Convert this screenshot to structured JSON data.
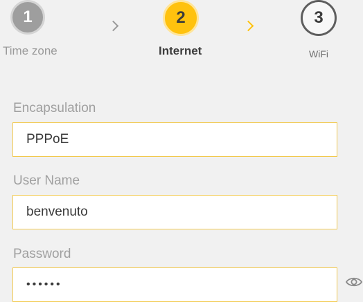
{
  "stepper": {
    "steps": [
      {
        "number": "1",
        "label": "Time zone",
        "state": "completed"
      },
      {
        "number": "2",
        "label": "Internet",
        "state": "active"
      },
      {
        "number": "3",
        "label": "WiFi",
        "state": "pending"
      }
    ],
    "separator_icon": "chevron-right-icon"
  },
  "form": {
    "encapsulation": {
      "label": "Encapsulation",
      "value": "PPPoE"
    },
    "username": {
      "label": "User Name",
      "value": "benvenuto"
    },
    "password": {
      "label": "Password",
      "masked_value": "••••••",
      "toggle_icon": "eye-icon"
    }
  },
  "colors": {
    "accent": "#ffc20e",
    "input_border": "#f2c94c",
    "background": "#f1f1f1",
    "label_text": "#a0a0a0"
  }
}
